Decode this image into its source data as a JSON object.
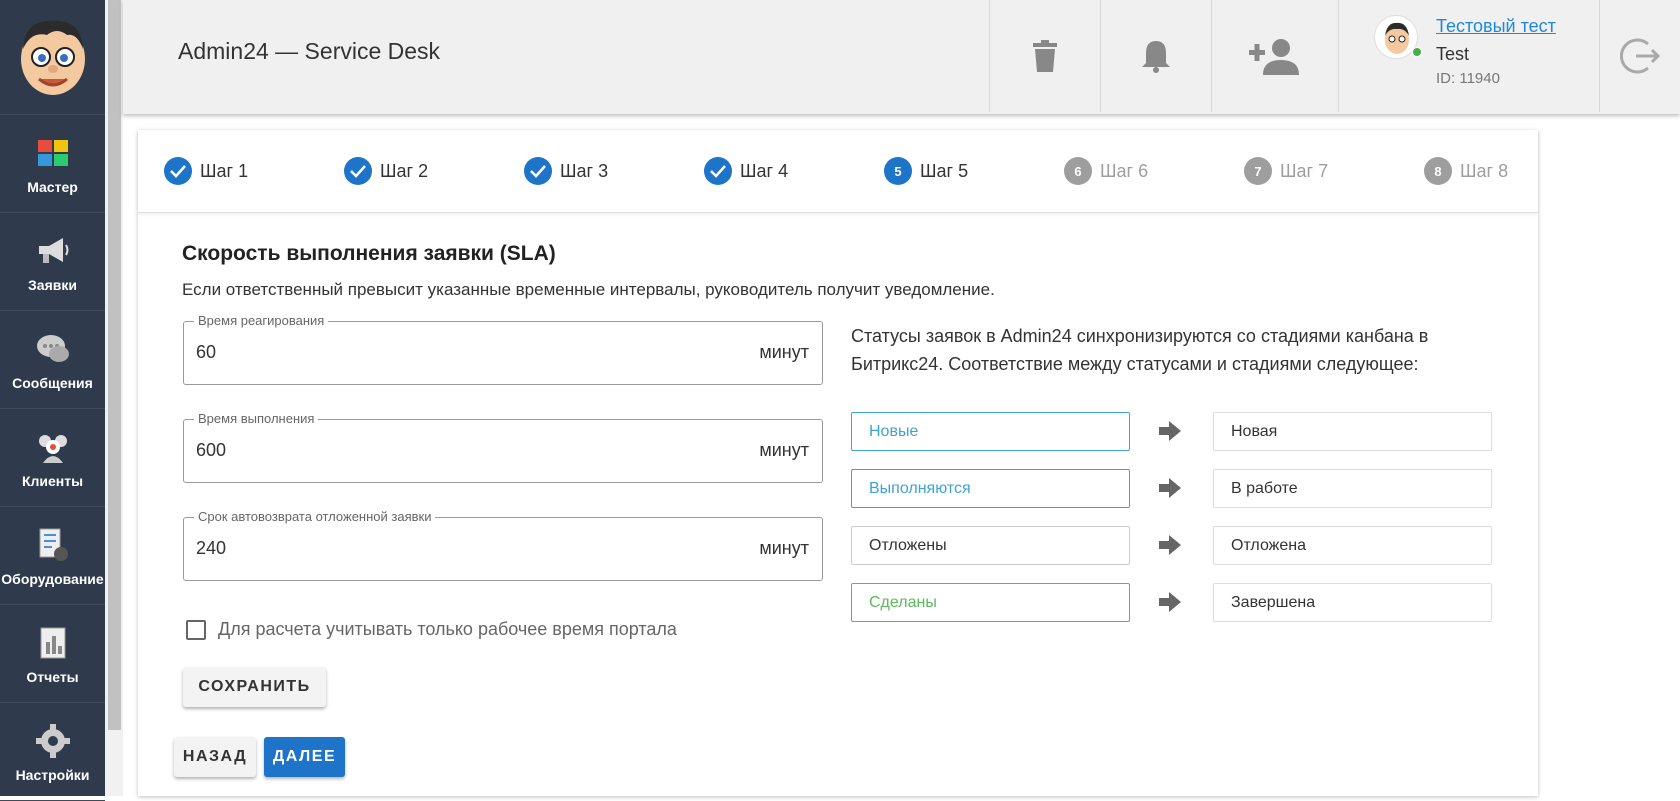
{
  "sidebar": {
    "items": [
      {
        "label": "Мастер",
        "icon": "wizard-icon"
      },
      {
        "label": "Заявки",
        "icon": "megaphone-icon"
      },
      {
        "label": "Сообщения",
        "icon": "chat-icon"
      },
      {
        "label": "Клиенты",
        "icon": "clients-icon"
      },
      {
        "label": "Оборудование",
        "icon": "equipment-icon"
      },
      {
        "label": "Отчеты",
        "icon": "reports-icon"
      },
      {
        "label": "Настройки",
        "icon": "gear-icon"
      }
    ]
  },
  "header": {
    "title": "Admin24 — Service Desk",
    "user": {
      "name": "Тестовый тест",
      "login": "Test",
      "id": "ID: 11940",
      "status": "online"
    }
  },
  "steps": [
    {
      "num": "1",
      "label": "Шаг 1",
      "state": "done"
    },
    {
      "num": "2",
      "label": "Шаг 2",
      "state": "done"
    },
    {
      "num": "3",
      "label": "Шаг 3",
      "state": "done"
    },
    {
      "num": "4",
      "label": "Шаг 4",
      "state": "done"
    },
    {
      "num": "5",
      "label": "Шаг 5",
      "state": "active"
    },
    {
      "num": "6",
      "label": "Шаг 6",
      "state": "todo"
    },
    {
      "num": "7",
      "label": "Шаг 7",
      "state": "todo"
    },
    {
      "num": "8",
      "label": "Шаг 8",
      "state": "todo"
    }
  ],
  "sla": {
    "title": "Скорость выполнения заявки (SLA)",
    "description": "Если ответственный превысит указанные временные интервалы, руководитель получит уведомление.",
    "fields": [
      {
        "label": "Время реагирования",
        "value": "60",
        "unit": "минут"
      },
      {
        "label": "Время выполнения",
        "value": "600",
        "unit": "минут"
      },
      {
        "label": "Срок автовозврата отложенной заявки",
        "value": "240",
        "unit": "минут"
      }
    ],
    "checkbox_label": "Для расчета учитывать только рабочее время портала",
    "checkbox_checked": false,
    "save_label": "СОХРАНИТЬ"
  },
  "statuses": {
    "info": "Статусы заявок в Admin24 синхронизируются со стадиями канбана в Битрикс24. Соответствие между статусами и стадиями следующее:",
    "rows": [
      {
        "status": "Новые",
        "stage": "Новая",
        "color": "#3ea3d6"
      },
      {
        "status": "Выполняются",
        "stage": "В работе",
        "color": "#3ea3d6"
      },
      {
        "status": "Отложены",
        "stage": "Отложена",
        "color": "#333333"
      },
      {
        "status": "Сделаны",
        "stage": "Завершена",
        "color": "#5cb85c"
      }
    ]
  },
  "nav": {
    "back_label": "НАЗАД",
    "next_label": "ДАЛЕЕ"
  },
  "colors": {
    "primary": "#1e74c8",
    "sidebar": "#2f3b4c",
    "step_todo": "#9e9e9e"
  }
}
